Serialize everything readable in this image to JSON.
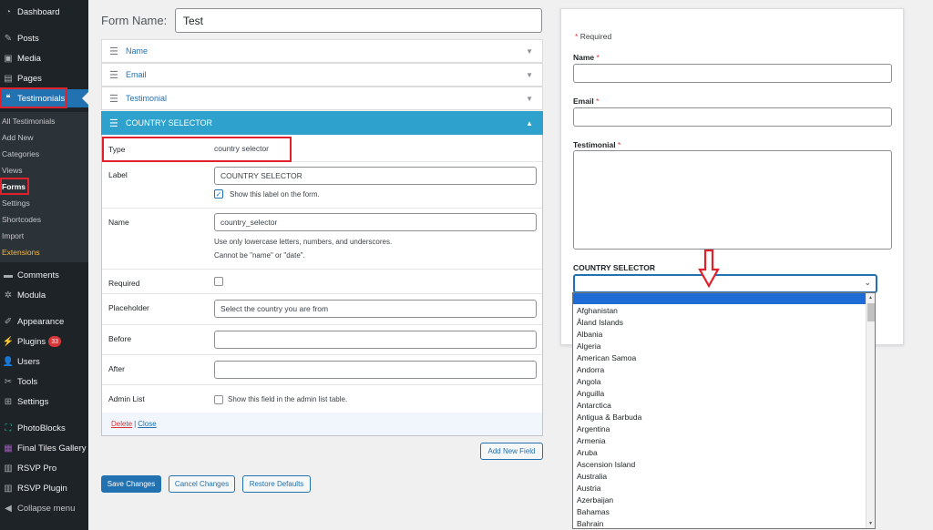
{
  "sidebar": {
    "menu": [
      {
        "label": "Dashboard",
        "icon": "dashboard-icon"
      },
      {
        "label": "Posts",
        "icon": "pin-icon"
      },
      {
        "label": "Media",
        "icon": "media-icon"
      },
      {
        "label": "Pages",
        "icon": "pages-icon"
      },
      {
        "label": "Testimonials",
        "icon": "quote-icon"
      },
      {
        "label": "Comments",
        "icon": "comments-icon"
      },
      {
        "label": "Modula",
        "icon": "modula-icon"
      },
      {
        "label": "Appearance",
        "icon": "brush-icon"
      },
      {
        "label": "Plugins",
        "icon": "plugin-icon",
        "badge": "33"
      },
      {
        "label": "Users",
        "icon": "users-icon"
      },
      {
        "label": "Tools",
        "icon": "wrench-icon"
      },
      {
        "label": "Settings",
        "icon": "settings-icon"
      },
      {
        "label": "PhotoBlocks",
        "icon": "photoblocks-icon"
      },
      {
        "label": "Final Tiles Gallery",
        "icon": "tiles-icon"
      },
      {
        "label": "RSVP Pro",
        "icon": "rsvp-icon"
      },
      {
        "label": "RSVP Plugin",
        "icon": "rsvp-plugin-icon"
      },
      {
        "label": "Collapse menu",
        "icon": "collapse-icon"
      }
    ],
    "submenu": [
      "All Testimonials",
      "Add New",
      "Categories",
      "Views",
      "Forms",
      "Settings",
      "Shortcodes",
      "Import",
      "Extensions"
    ]
  },
  "form": {
    "name_label": "Form Name:",
    "name_value": "Test",
    "fields": [
      "Name",
      "Email",
      "Testimonial",
      "COUNTRY SELECTOR"
    ],
    "props": {
      "type_label": "Type",
      "type_value": "country selector",
      "label_label": "Label",
      "label_value": "COUNTRY SELECTOR",
      "show_label_text": "Show this label on the form.",
      "name_label": "Name",
      "name_value": "country_selector",
      "name_help1": "Use only lowercase letters, numbers, and underscores.",
      "name_help2": "Cannot be \"name\" or \"date\".",
      "required_label": "Required",
      "placeholder_label": "Placeholder",
      "placeholder_value": "Select the country you are from",
      "before_label": "Before",
      "after_label": "After",
      "admin_list_label": "Admin List",
      "admin_list_text": "Show this field in the admin list table."
    },
    "footer": {
      "delete": "Delete",
      "sep": "|",
      "close": "Close"
    },
    "add_field": "Add New Field",
    "save": "Save Changes",
    "cancel": "Cancel Changes",
    "restore": "Restore Defaults"
  },
  "preview": {
    "required_note": "Required",
    "asterisk": "*",
    "name_label": "Name",
    "email_label": "Email",
    "testimonial_label": "Testimonial",
    "country_label": "COUNTRY SELECTOR"
  },
  "dropdown": {
    "options": [
      "Afghanistan",
      "Åland Islands",
      "Albania",
      "Algeria",
      "American Samoa",
      "Andorra",
      "Angola",
      "Anguilla",
      "Antarctica",
      "Antigua & Barbuda",
      "Argentina",
      "Armenia",
      "Aruba",
      "Ascension Island",
      "Australia",
      "Austria",
      "Azerbaijan",
      "Bahamas",
      "Bahrain"
    ]
  },
  "colors": {
    "accent": "#2271b1",
    "open_field": "#2ea2cc",
    "highlight": "#e0202b",
    "sidebar": "#1d2327"
  }
}
